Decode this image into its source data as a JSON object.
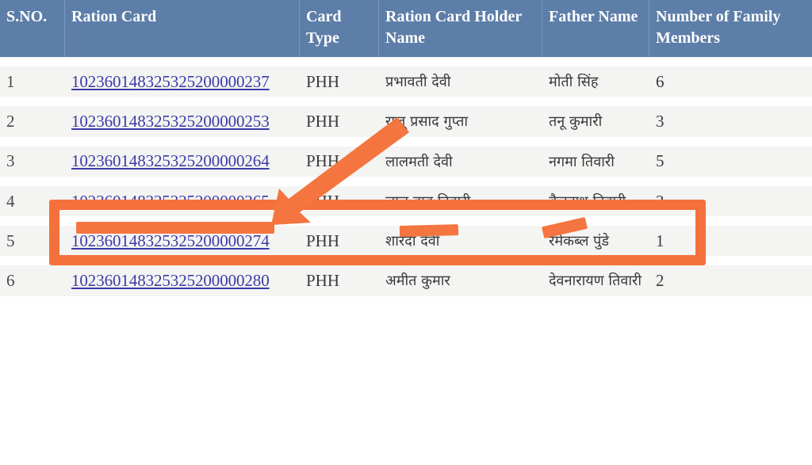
{
  "table": {
    "columns": [
      {
        "key": "sno",
        "label": "S.NO."
      },
      {
        "key": "card",
        "label": "Ration Card"
      },
      {
        "key": "type",
        "label": "Card Type"
      },
      {
        "key": "name",
        "label": "Ration Card Holder Name"
      },
      {
        "key": "father",
        "label": "Father Name"
      },
      {
        "key": "count",
        "label": "Number of Family Members"
      }
    ],
    "rows": [
      {
        "sno": "1",
        "card": "102360148325325200000237",
        "type": "PHH",
        "name": "प्रभावती देवी",
        "father": "मोती सिंह",
        "count": "6"
      },
      {
        "sno": "2",
        "card": "102360148325325200000253",
        "type": "PHH",
        "name": "राजू प्रसाद गुप्ता",
        "father": "तनू कुमारी",
        "count": "3"
      },
      {
        "sno": "3",
        "card": "102360148325325200000264",
        "type": "PHH",
        "name": "लालमती देवी",
        "father": "नगमा तिवारी",
        "count": "5"
      },
      {
        "sno": "4",
        "card": "102360148325325200000265",
        "type": "PHH",
        "name": "लाल बाबु तिवारी",
        "father": "बैजनाथ तिवारी",
        "count": "3"
      },
      {
        "sno": "5",
        "card": "102360148325325200000274",
        "type": "PHH",
        "name": "शारदा देवी",
        "father": "रमेकब्ल पुंडे",
        "count": "1"
      },
      {
        "sno": "6",
        "card": "102360148325325200000280",
        "type": "PHH",
        "name": "अमीत कुमार",
        "father": "देवनारायण तिवारी",
        "count": "2"
      }
    ]
  },
  "annotations": {
    "highlight_row_index": 3,
    "highlight_color": "#f4713b",
    "arrow_color": "#f4753f",
    "arrow_points_to": "ration-card-row-3",
    "redaction_color": "#f4753f",
    "redacted_fields": [
      "card",
      "name",
      "father"
    ]
  },
  "colors": {
    "header_background": "#5d7ea8",
    "header_text": "#ffffff",
    "row_background": "#f4f4f3",
    "page_background": "#ffffff",
    "link_text": "#3b3ba8",
    "body_text": "#3a3a3a"
  }
}
